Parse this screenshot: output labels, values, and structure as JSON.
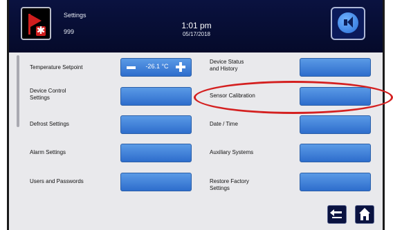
{
  "header": {
    "title": "Settings",
    "device_id": "999",
    "time": "1:01 pm",
    "date": "05/17/2018",
    "icons": {
      "alarm": "alarm-flag-snowflake-icon",
      "sound": "speaker-icon"
    }
  },
  "left_column": [
    {
      "label": "Temperature Setpoint",
      "control": "stepper",
      "value": "-26.1 °C"
    },
    {
      "label": "Device Control\nSettings",
      "control": "button"
    },
    {
      "label": "Defrost Settings",
      "control": "button"
    },
    {
      "label": "Alarm Settings",
      "control": "button"
    },
    {
      "label": "Users and Passwords",
      "control": "button"
    }
  ],
  "right_column": [
    {
      "label": "Device Status\nand History",
      "control": "button"
    },
    {
      "label": "Sensor Calibration",
      "control": "button",
      "highlighted": true
    },
    {
      "label": "Date / Time",
      "control": "button"
    },
    {
      "label": "Auxiliary Systems",
      "control": "button"
    },
    {
      "label": "Restore Factory\nSettings",
      "control": "button"
    }
  ],
  "footer": {
    "back_icon": "back-arrow-icon",
    "home_icon": "home-icon"
  },
  "colors": {
    "header_bg": "#0a1240",
    "button": "#3d7fdb",
    "highlight": "#d42020",
    "panel": "#e9e9ec"
  }
}
